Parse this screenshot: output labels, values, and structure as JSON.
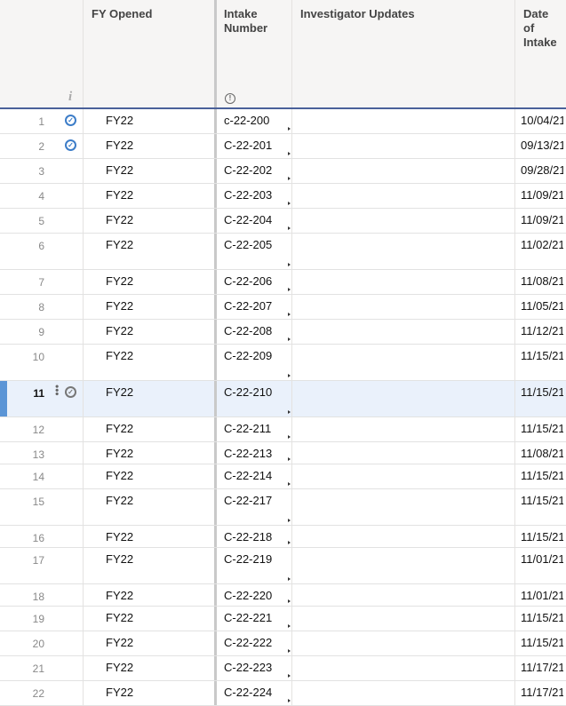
{
  "columns": {
    "info": "i",
    "fy": "FY Opened",
    "intake": "Intake Number",
    "updates": "Investigator Updates",
    "date": "Date of Intake"
  },
  "rows": [
    {
      "n": "1",
      "fy": "FY22",
      "intake": "c-22-200",
      "date": "10/04/21",
      "sync": true
    },
    {
      "n": "2",
      "fy": "FY22",
      "intake": "C-22-201",
      "date": "09/13/21",
      "sync": true
    },
    {
      "n": "3",
      "fy": "FY22",
      "intake": "C-22-202",
      "date": "09/28/21"
    },
    {
      "n": "4",
      "fy": "FY22",
      "intake": "C-22-203",
      "date": "11/09/21"
    },
    {
      "n": "5",
      "fy": "FY22",
      "intake": "C-22-204",
      "date": "11/09/21"
    },
    {
      "n": "6",
      "fy": "FY22",
      "intake": "C-22-205",
      "date": "11/02/21"
    },
    {
      "n": "7",
      "fy": "FY22",
      "intake": "C-22-206",
      "date": "11/08/21"
    },
    {
      "n": "8",
      "fy": "FY22",
      "intake": "C-22-207",
      "date": "11/05/21"
    },
    {
      "n": "9",
      "fy": "FY22",
      "intake": "C-22-208",
      "date": "11/12/21"
    },
    {
      "n": "10",
      "fy": "FY22",
      "intake": "C-22-209",
      "date": "11/15/21"
    },
    {
      "n": "11",
      "fy": "FY22",
      "intake": "C-22-210",
      "date": "11/15/21",
      "selected": true,
      "sync": true
    },
    {
      "n": "12",
      "fy": "FY22",
      "intake": "C-22-211",
      "date": "11/15/21"
    },
    {
      "n": "13",
      "fy": "FY22",
      "intake": "C-22-213",
      "date": "11/08/21"
    },
    {
      "n": "14",
      "fy": "FY22",
      "intake": "C-22-214",
      "date": "11/15/21"
    },
    {
      "n": "15",
      "fy": "FY22",
      "intake": "C-22-217",
      "date": "11/15/21"
    },
    {
      "n": "16",
      "fy": "FY22",
      "intake": "C-22-218",
      "date": "11/15/21"
    },
    {
      "n": "17",
      "fy": "FY22",
      "intake": "C-22-219",
      "date": "11/01/21"
    },
    {
      "n": "18",
      "fy": "FY22",
      "intake": "C-22-220",
      "date": "11/01/21"
    },
    {
      "n": "19",
      "fy": "FY22",
      "intake": "C-22-221",
      "date": "11/15/21"
    },
    {
      "n": "20",
      "fy": "FY22",
      "intake": "C-22-222",
      "date": "11/15/21"
    },
    {
      "n": "21",
      "fy": "FY22",
      "intake": "C-22-223",
      "date": "11/17/21"
    },
    {
      "n": "22",
      "fy": "FY22",
      "intake": "C-22-224",
      "date": "11/17/21"
    }
  ],
  "colors": {
    "accent": "#4a6199",
    "selection": "#eaf1fb",
    "sync_icon": "#3d7dc8"
  }
}
